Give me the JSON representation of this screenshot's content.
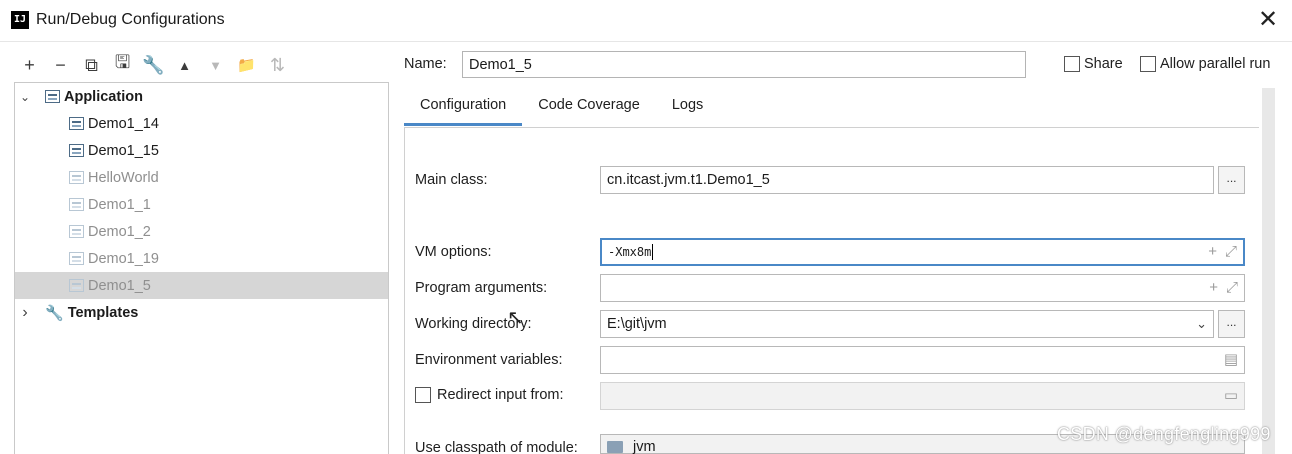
{
  "window": {
    "logo_text": "IJ",
    "title": "Run/Debug Configurations",
    "close_glyph": "✕"
  },
  "toolbar": {
    "buttons": [
      {
        "name": "add-icon",
        "glyph": "+"
      },
      {
        "name": "remove-icon",
        "glyph": "−"
      },
      {
        "name": "copy-icon",
        "glyph": "⧉"
      },
      {
        "name": "save-icon",
        "glyph": "🖫"
      },
      {
        "name": "wrench-icon",
        "glyph": "🔧"
      },
      {
        "name": "move-up-icon",
        "glyph": "▲"
      },
      {
        "name": "move-down-icon",
        "glyph": "▼"
      },
      {
        "name": "folder-add-icon",
        "glyph": "📁"
      },
      {
        "name": "sort-icon",
        "glyph": "⇅"
      }
    ]
  },
  "tree": {
    "application": {
      "label": "Application",
      "arrow": "⌄"
    },
    "items": [
      {
        "label": "Demo1_14",
        "style": "dark"
      },
      {
        "label": "Demo1_15",
        "style": "dark"
      },
      {
        "label": "HelloWorld",
        "style": "gray"
      },
      {
        "label": "Demo1_1",
        "style": "gray"
      },
      {
        "label": "Demo1_2",
        "style": "gray"
      },
      {
        "label": "Demo1_19",
        "style": "gray"
      },
      {
        "label": "Demo1_5",
        "style": "gray",
        "selected": true
      }
    ],
    "templates": {
      "label": "Templates",
      "arrow": "›"
    }
  },
  "name": {
    "label": "Name:",
    "value": "Demo1_5"
  },
  "share": {
    "label": "Share",
    "checked": false
  },
  "parallel": {
    "label": "Allow parallel run",
    "checked": false
  },
  "tabs": [
    {
      "label": "Configuration",
      "active": true
    },
    {
      "label": "Code Coverage",
      "active": false
    },
    {
      "label": "Logs",
      "active": false
    }
  ],
  "form": {
    "main_class": {
      "label": "Main class:",
      "value": "cn.itcast.jvm.t1.Demo1_5",
      "browse": "..."
    },
    "vm_options": {
      "label": "VM options:",
      "value": "-Xmx8m"
    },
    "program_arguments": {
      "label": "Program arguments:",
      "value": ""
    },
    "working_directory": {
      "label": "Working directory:",
      "value": "E:\\git\\jvm",
      "browse": "..."
    },
    "environment_variables": {
      "label": "Environment variables:",
      "value": ""
    },
    "redirect_input": {
      "label": "Redirect input from:",
      "checked": false,
      "value": ""
    },
    "classpath_module": {
      "label": "Use classpath of module:",
      "value": "jvm"
    }
  },
  "watermark": "CSDN @dengfengling999"
}
